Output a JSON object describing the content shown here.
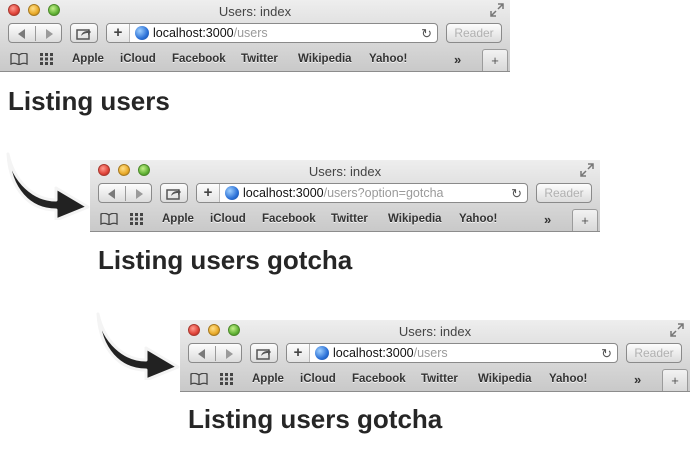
{
  "browsers": [
    {
      "window_title": "Users: index",
      "url_host": "localhost:3000",
      "url_path": "/users",
      "reader_label": "Reader",
      "bookmarks": [
        "Apple",
        "iCloud",
        "Facebook",
        "Twitter",
        "Wikipedia",
        "Yahoo!"
      ],
      "more_label": "»",
      "heading": "Listing users"
    },
    {
      "window_title": "Users: index",
      "url_host": "localhost:3000",
      "url_path": "/users?option=gotcha",
      "reader_label": "Reader",
      "bookmarks": [
        "Apple",
        "iCloud",
        "Facebook",
        "Twitter",
        "Wikipedia",
        "Yahoo!"
      ],
      "more_label": "»",
      "heading": "Listing users gotcha"
    },
    {
      "window_title": "Users: index",
      "url_host": "localhost:3000",
      "url_path": "/users",
      "reader_label": "Reader",
      "bookmarks": [
        "Apple",
        "iCloud",
        "Facebook",
        "Twitter",
        "Wikipedia",
        "Yahoo!"
      ],
      "more_label": "»",
      "heading": "Listing users gotcha"
    }
  ],
  "icons": {
    "arrow": "curved-arrow-icon",
    "globe": "globe-icon",
    "reload": "reload-icon",
    "share": "share-icon",
    "reading_list": "book-icon",
    "top_sites": "grid-icon",
    "new_tab": "plus-icon"
  },
  "colors": {
    "heading": "#262626",
    "url_path": "#9a9a9a",
    "reader_disabled": "#b1b1b1"
  }
}
